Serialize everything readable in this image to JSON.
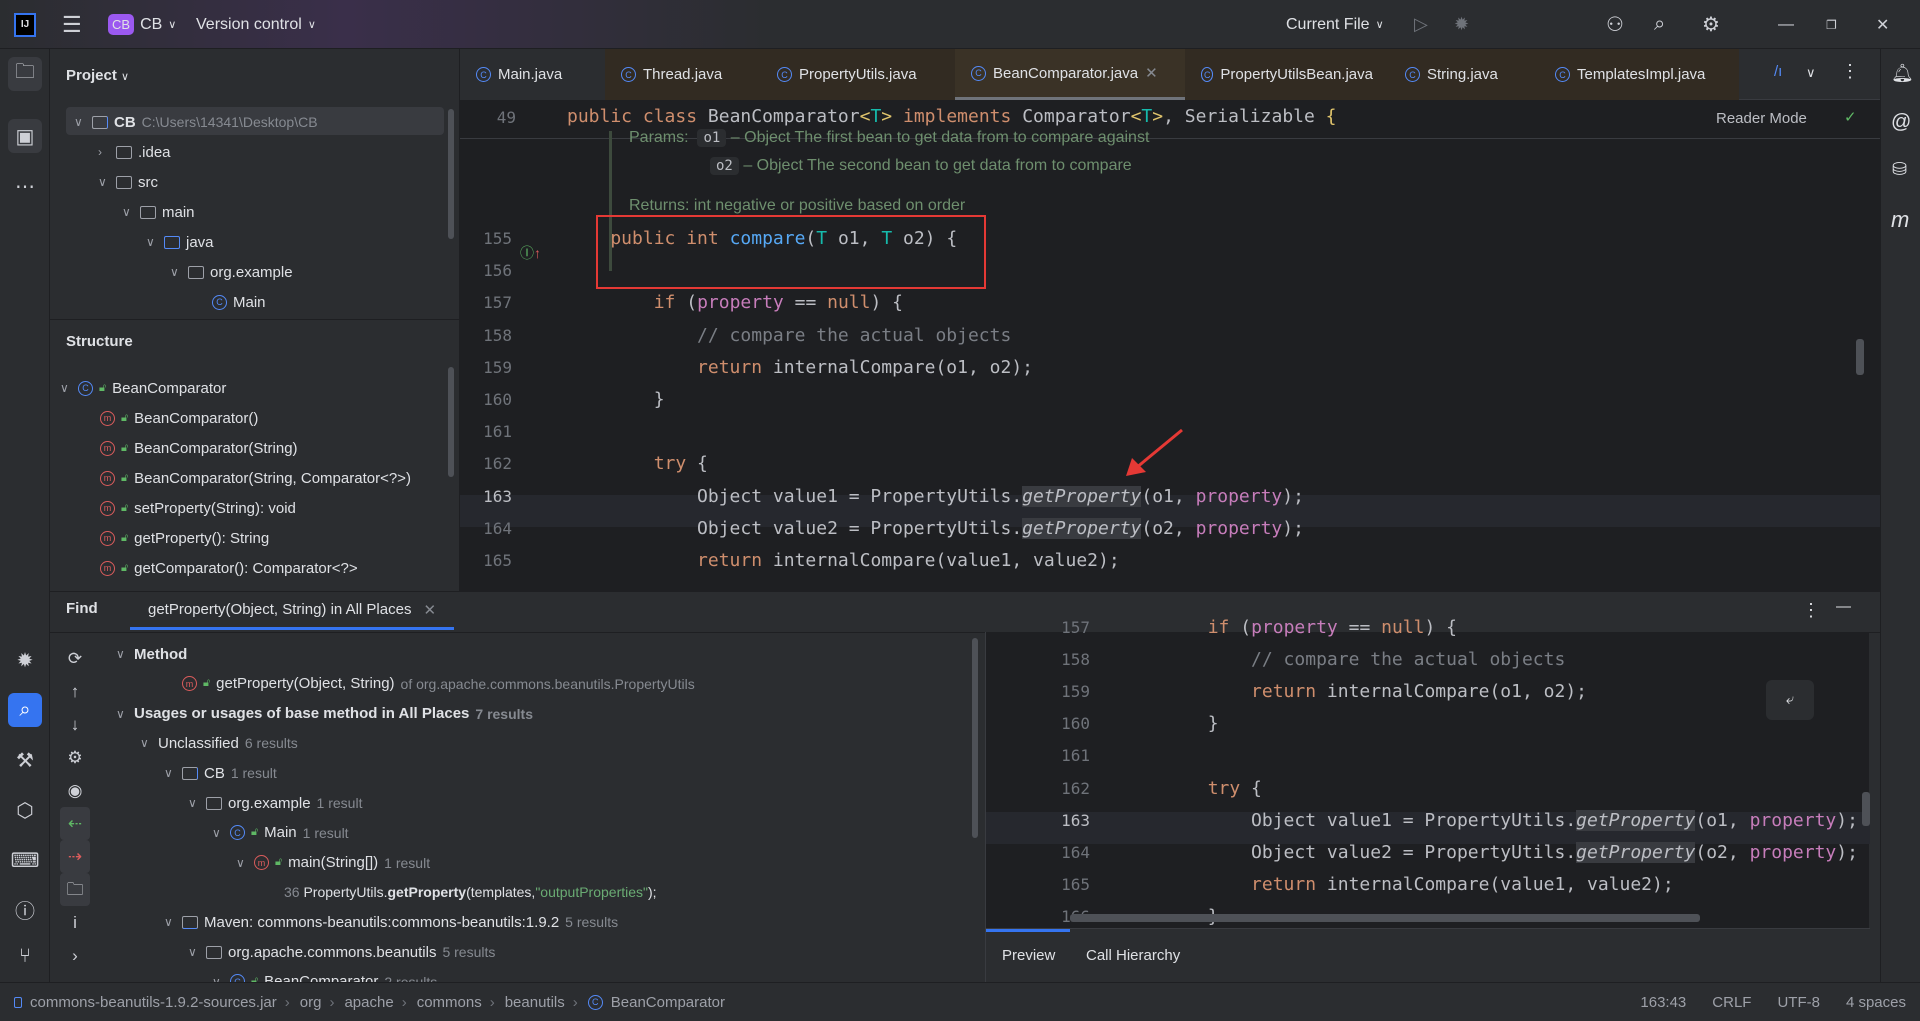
{
  "topbar": {
    "logo": "IJ",
    "project_badge": "CB",
    "project": "CB",
    "vcs": "Version control",
    "run_config": "Current File"
  },
  "project_panel": {
    "title": "Project",
    "tree": [
      {
        "label": "CB",
        "extra": "C:\\Users\\14341\\Desktop\\CB",
        "depth": 0,
        "chev": "v",
        "icon": "folder-module"
      },
      {
        "label": ".idea",
        "depth": 1,
        "chev": ">",
        "icon": "folder"
      },
      {
        "label": "src",
        "depth": 1,
        "chev": "v",
        "icon": "folder"
      },
      {
        "label": "main",
        "depth": 2,
        "chev": "v",
        "icon": "folder"
      },
      {
        "label": "java",
        "depth": 3,
        "chev": "v",
        "icon": "folder-source"
      },
      {
        "label": "org.example",
        "depth": 4,
        "chev": "v",
        "icon": "package"
      },
      {
        "label": "Main",
        "depth": 5,
        "chev": "",
        "icon": "class"
      }
    ]
  },
  "structure": {
    "title": "Structure",
    "items": [
      {
        "label": "BeanComparator",
        "icon": "class",
        "depth": 0
      },
      {
        "label": "BeanComparator()",
        "icon": "method",
        "depth": 1
      },
      {
        "label": "BeanComparator(String)",
        "icon": "method",
        "depth": 1
      },
      {
        "label": "BeanComparator(String, Comparator<?>)",
        "icon": "method",
        "depth": 1
      },
      {
        "label": "setProperty(String): void",
        "icon": "method",
        "depth": 1
      },
      {
        "label": "getProperty(): String",
        "icon": "method",
        "depth": 1
      },
      {
        "label": "getComparator(): Comparator<?>",
        "icon": "method",
        "depth": 1
      }
    ]
  },
  "editor": {
    "tabs": [
      "Main.java",
      "Thread.java",
      "PropertyUtils.java",
      "BeanComparator.java",
      "PropertyUtilsBean.java",
      "String.java",
      "TemplatesImpl.java"
    ],
    "active_tab": "BeanComparator.java",
    "reader_mode": "Reader Mode",
    "sticky": {
      "line": "49",
      "tokens": [
        [
          "public class ",
          "kw"
        ],
        [
          "BeanComparator",
          ""
        ],
        [
          "<",
          "br"
        ],
        [
          "T",
          "tp"
        ],
        [
          "> ",
          "br"
        ],
        [
          "implements ",
          "kw"
        ],
        [
          "Comparator",
          ""
        ],
        [
          "<",
          "br"
        ],
        [
          "T",
          "tp"
        ],
        [
          ">",
          "br"
        ],
        [
          ", Serializable ",
          ""
        ],
        [
          "{",
          "br"
        ]
      ]
    },
    "doc": {
      "params_label": "Params:",
      "p1": "o1",
      "p1_text": "– Object The first bean to get data from to compare against",
      "p2": "o2",
      "p2_text": "– Object The second bean to get data from to compare",
      "returns": "Returns: int negative or positive based on order"
    },
    "lines": [
      {
        "n": "155",
        "tokens": [
          [
            "    public int ",
            "kw"
          ],
          [
            "compare",
            "fn"
          ],
          [
            "(",
            ""
          ],
          [
            "T ",
            "tp"
          ],
          [
            "o1, ",
            ""
          ],
          [
            "T ",
            "tp"
          ],
          [
            "o2) {",
            ""
          ]
        ]
      },
      {
        "n": "156",
        "tokens": []
      },
      {
        "n": "157",
        "tokens": [
          [
            "        if ",
            "kw"
          ],
          [
            "(",
            ""
          ],
          [
            "property",
            "fld"
          ],
          [
            " == ",
            ""
          ],
          [
            "null",
            "kw"
          ],
          [
            ") {",
            ""
          ]
        ]
      },
      {
        "n": "158",
        "tokens": [
          [
            "            // compare the actual objects",
            "cm"
          ]
        ]
      },
      {
        "n": "159",
        "tokens": [
          [
            "            return ",
            "kw"
          ],
          [
            "internalCompare(o1, o2);",
            ""
          ]
        ]
      },
      {
        "n": "160",
        "tokens": [
          [
            "        }",
            ""
          ]
        ]
      },
      {
        "n": "161",
        "tokens": []
      },
      {
        "n": "162",
        "tokens": [
          [
            "        try ",
            "kw"
          ],
          [
            "{",
            ""
          ]
        ]
      },
      {
        "n": "163",
        "tokens": [
          [
            "            Object value1 = PropertyUtils.",
            ""
          ],
          [
            "getProperty",
            "it"
          ],
          [
            "(o1, ",
            ""
          ],
          [
            "property",
            "fld"
          ],
          [
            ");",
            ""
          ]
        ]
      },
      {
        "n": "164",
        "tokens": [
          [
            "            Object value2 = PropertyUtils.",
            ""
          ],
          [
            "getProperty",
            "it"
          ],
          [
            "(o2, ",
            ""
          ],
          [
            "property",
            "fld"
          ],
          [
            ");",
            ""
          ]
        ]
      },
      {
        "n": "165",
        "tokens": [
          [
            "            return ",
            "kw"
          ],
          [
            "internalCompare(value1, value2);",
            ""
          ]
        ]
      }
    ]
  },
  "find": {
    "label": "Find",
    "tab": "getProperty(Object, String) in All Places",
    "rows": [
      {
        "depth": 0,
        "chev": "v",
        "label": "Method",
        "bold": true
      },
      {
        "depth": 2,
        "chev": "",
        "icon": "method",
        "label": "getProperty(Object, String)",
        "extra": "of org.apache.commons.beanutils.PropertyUtils"
      },
      {
        "depth": 0,
        "chev": "v",
        "label": "Usages or usages of base method in All Places",
        "bold": true,
        "extra": "7 results"
      },
      {
        "depth": 1,
        "chev": "v",
        "label": "Unclassified",
        "extra": "6 results"
      },
      {
        "depth": 2,
        "chev": "v",
        "icon": "folder-module",
        "label": "CB",
        "extra": "1 result"
      },
      {
        "depth": 3,
        "chev": "v",
        "icon": "package",
        "label": "org.example",
        "extra": "1 result"
      },
      {
        "depth": 4,
        "chev": "v",
        "icon": "class",
        "label": "Main",
        "extra": "1 result"
      },
      {
        "depth": 5,
        "chev": "v",
        "icon": "method",
        "label": "main(String[])",
        "extra": "1 result"
      },
      {
        "depth": 7,
        "chev": "",
        "usage": true,
        "lineno": "36",
        "pre": "PropertyUtils.",
        "hl": "getProperty",
        "post": "(templates,",
        "str": "\"outputProperties\"",
        "end": ");"
      },
      {
        "depth": 2,
        "chev": "v",
        "icon": "folder-lib",
        "label": "Maven: commons-beanutils:commons-beanutils:1.9.2",
        "extra": "5 results"
      },
      {
        "depth": 3,
        "chev": "v",
        "icon": "package",
        "label": "org.apache.commons.beanutils",
        "extra": "5 results"
      },
      {
        "depth": 4,
        "chev": "v",
        "icon": "class",
        "label": "BeanComparator",
        "extra": "2 results"
      }
    ],
    "preview_tabs": [
      "Preview",
      "Call Hierarchy"
    ],
    "preview_lines": [
      {
        "n": "157",
        "tokens": [
          [
            "        if ",
            "kw"
          ],
          [
            "(",
            ""
          ],
          [
            "property",
            "fld"
          ],
          [
            " == ",
            ""
          ],
          [
            "null",
            "kw"
          ],
          [
            ") {",
            ""
          ]
        ]
      },
      {
        "n": "158",
        "tokens": [
          [
            "            // compare the actual objects",
            "cm"
          ]
        ]
      },
      {
        "n": "159",
        "tokens": [
          [
            "            return ",
            "kw"
          ],
          [
            "internalCompare(o1, o2);",
            ""
          ]
        ]
      },
      {
        "n": "160",
        "tokens": [
          [
            "        }",
            ""
          ]
        ]
      },
      {
        "n": "161",
        "tokens": []
      },
      {
        "n": "162",
        "tokens": [
          [
            "        try ",
            "kw"
          ],
          [
            "{",
            ""
          ]
        ]
      },
      {
        "n": "163",
        "tokens": [
          [
            "            Object value1 = PropertyUtils.",
            ""
          ],
          [
            "getProperty",
            "it"
          ],
          [
            "(o1, ",
            ""
          ],
          [
            "property",
            "fld"
          ],
          [
            ");",
            ""
          ]
        ]
      },
      {
        "n": "164",
        "tokens": [
          [
            "            Object value2 = PropertyUtils.",
            ""
          ],
          [
            "getProperty",
            "it"
          ],
          [
            "(o2, ",
            ""
          ],
          [
            "property",
            "fld"
          ],
          [
            ");",
            ""
          ]
        ]
      },
      {
        "n": "165",
        "tokens": [
          [
            "            return ",
            "kw"
          ],
          [
            "internalCompare(value1, value2);",
            ""
          ]
        ]
      },
      {
        "n": "166",
        "tokens": [
          [
            "        }",
            ""
          ]
        ]
      }
    ]
  },
  "status": {
    "crumbs": [
      "commons-beanutils-1.9.2-sources.jar",
      "org",
      "apache",
      "commons",
      "beanutils",
      "BeanComparator"
    ],
    "position": "163:43",
    "line_sep": "CRLF",
    "encoding": "UTF-8",
    "indent": "4 spaces"
  },
  "colors": {
    "accent": "#3574f0",
    "highlight_box": "#e53935",
    "keyword": "#cf8e6d",
    "function": "#56a8f5",
    "field": "#c77dbb",
    "string": "#6aab73"
  }
}
